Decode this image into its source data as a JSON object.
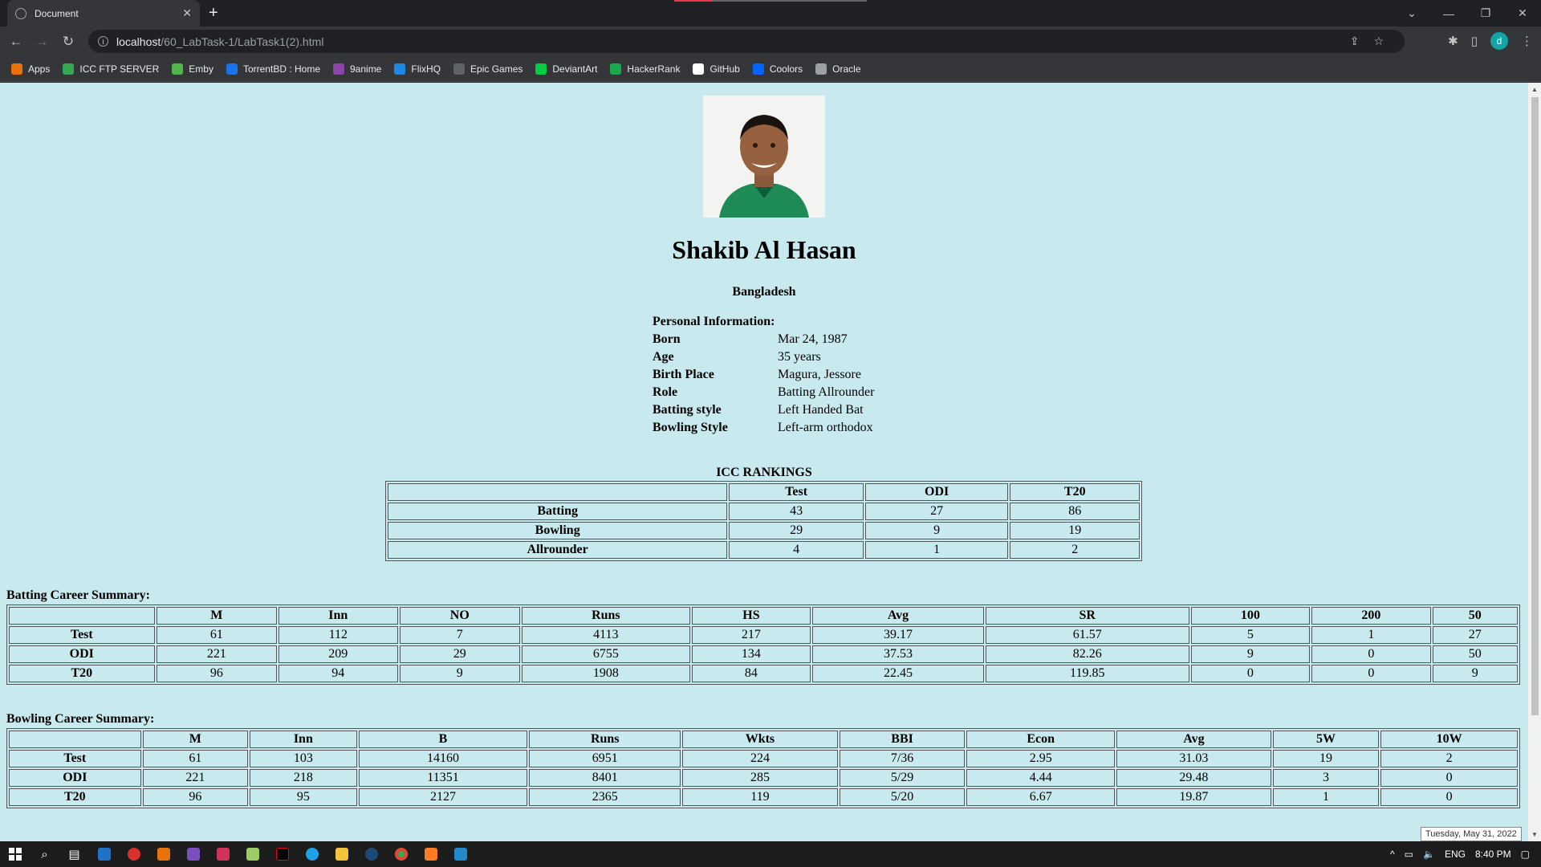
{
  "browser": {
    "tab_title": "Document",
    "url_host": "localhost",
    "url_path": "/60_LabTask-1/LabTask1(2).html",
    "avatar_letter": "d",
    "bookmarks": [
      {
        "label": "Apps",
        "icon": "apps-grid-icon",
        "color": "#e8710a"
      },
      {
        "label": "ICC FTP SERVER",
        "icon": "leaf-icon",
        "color": "#34a853"
      },
      {
        "label": "Emby",
        "icon": "emby-icon",
        "color": "#52b54b"
      },
      {
        "label": "TorrentBD : Home",
        "icon": "torrentbd-icon",
        "color": "#1a73e8"
      },
      {
        "label": "9anime",
        "icon": "play-icon",
        "color": "#8e44ad"
      },
      {
        "label": "FlixHQ",
        "icon": "flixhq-icon",
        "color": "#1e88e5"
      },
      {
        "label": "Epic Games",
        "icon": "epic-games-icon",
        "color": "#5f6368"
      },
      {
        "label": "DeviantArt",
        "icon": "deviantart-icon",
        "color": "#05cc47"
      },
      {
        "label": "HackerRank",
        "icon": "hackerrank-icon",
        "color": "#1ba94c"
      },
      {
        "label": "GitHub",
        "icon": "github-icon",
        "color": "#ffffff"
      },
      {
        "label": "Coolors",
        "icon": "coolors-icon",
        "color": "#0066ff"
      },
      {
        "label": "Oracle",
        "icon": "globe-icon",
        "color": "#9aa0a6"
      }
    ]
  },
  "profile": {
    "name": "Shakib Al Hasan",
    "country": "Bangladesh",
    "personal_heading": "Personal Information:",
    "personal": [
      {
        "key": "Born",
        "value": "Mar 24, 1987"
      },
      {
        "key": "Age",
        "value": "35 years"
      },
      {
        "key": "Birth Place",
        "value": "Magura, Jessore"
      },
      {
        "key": "Role",
        "value": "Batting Allrounder"
      },
      {
        "key": "Batting style",
        "value": "Left Handed Bat"
      },
      {
        "key": "Bowling Style",
        "value": "Left-arm orthodox"
      }
    ]
  },
  "rankings": {
    "caption": "ICC RANKINGS",
    "headers": [
      "",
      "Test",
      "ODI",
      "T20"
    ],
    "rows": [
      [
        "Batting",
        "43",
        "27",
        "86"
      ],
      [
        "Bowling",
        "29",
        "9",
        "19"
      ],
      [
        "Allrounder",
        "4",
        "1",
        "2"
      ]
    ]
  },
  "batting": {
    "label": "Batting Career Summary:",
    "headers": [
      "",
      "M",
      "Inn",
      "NO",
      "Runs",
      "HS",
      "Avg",
      "SR",
      "100",
      "200",
      "50"
    ],
    "rows": [
      [
        "Test",
        "61",
        "112",
        "7",
        "4113",
        "217",
        "39.17",
        "61.57",
        "5",
        "1",
        "27"
      ],
      [
        "ODI",
        "221",
        "209",
        "29",
        "6755",
        "134",
        "37.53",
        "82.26",
        "9",
        "0",
        "50"
      ],
      [
        "T20",
        "96",
        "94",
        "9",
        "1908",
        "84",
        "22.45",
        "119.85",
        "0",
        "0",
        "9"
      ]
    ]
  },
  "bowling": {
    "label": "Bowling Career Summary:",
    "headers": [
      "",
      "M",
      "Inn",
      "B",
      "Runs",
      "Wkts",
      "BBI",
      "Econ",
      "Avg",
      "5W",
      "10W"
    ],
    "rows": [
      [
        "Test",
        "61",
        "103",
        "14160",
        "6951",
        "224",
        "7/36",
        "2.95",
        "31.03",
        "19",
        "2"
      ],
      [
        "ODI",
        "221",
        "218",
        "11351",
        "8401",
        "285",
        "5/29",
        "4.44",
        "29.48",
        "3",
        "0"
      ],
      [
        "T20",
        "96",
        "95",
        "2127",
        "2365",
        "119",
        "5/20",
        "6.67",
        "19.87",
        "1",
        "0"
      ]
    ]
  },
  "taskbar": {
    "tooltip": "Tuesday, May 31, 2022",
    "lang": "ENG",
    "time": "8:40 PM"
  }
}
